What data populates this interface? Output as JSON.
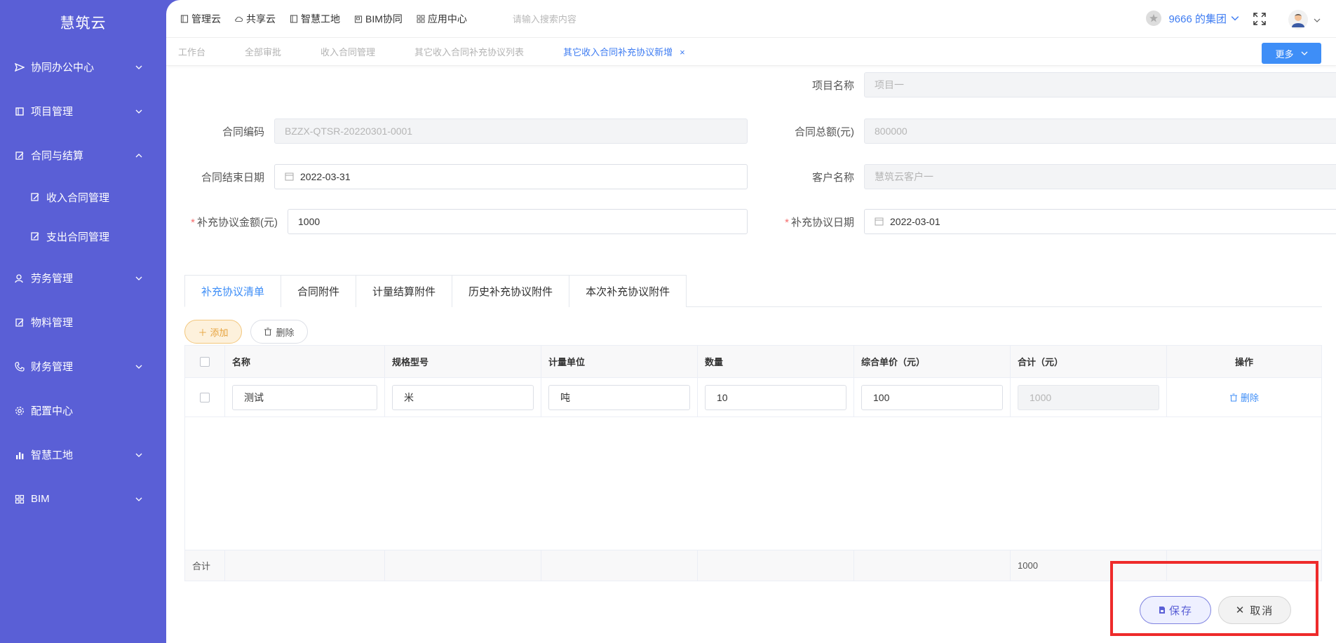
{
  "sidebar": {
    "title": "慧筑云",
    "items": [
      {
        "label": "协同办公中心",
        "icon": "send-icon",
        "expand": "down"
      },
      {
        "label": "项目管理",
        "icon": "book-icon",
        "expand": "down"
      },
      {
        "label": "合同与结算",
        "icon": "edit-doc-icon",
        "expand": "up"
      },
      {
        "label": "收入合同管理",
        "icon": "edit-doc-icon"
      },
      {
        "label": "支出合同管理",
        "icon": "edit-doc-icon"
      },
      {
        "label": "劳务管理",
        "icon": "user-icon",
        "expand": "down"
      },
      {
        "label": "物料管理",
        "icon": "edit-doc-icon"
      },
      {
        "label": "财务管理",
        "icon": "phone-icon",
        "expand": "down"
      },
      {
        "label": "配置中心",
        "icon": "gear-icon"
      },
      {
        "label": "智慧工地",
        "icon": "bar-chart-icon",
        "expand": "down"
      },
      {
        "label": "BIM",
        "icon": "grid-icon",
        "expand": "down"
      }
    ]
  },
  "topbar": {
    "nav": [
      "管理云",
      "共享云",
      "智慧工地",
      "BIM协同",
      "应用中心"
    ],
    "search_placeholder": "请输入搜索内容",
    "org": "9666 的集团"
  },
  "tabs": {
    "items": [
      "工作台",
      "全部审批",
      "收入合同管理",
      "其它收入合同补充协议列表",
      "其它收入合同补充协议新增"
    ],
    "close": "×",
    "more": "更多"
  },
  "form": {
    "project_name_label": "项目名称",
    "project_name": "项目一",
    "contract_code_label": "合同编码",
    "contract_code": "BZZX-QTSR-20220301-0001",
    "contract_total_label": "合同总额(元)",
    "contract_total": "800000",
    "contract_end_label": "合同结束日期",
    "contract_end": "2022-03-31",
    "customer_label": "客户名称",
    "customer": "慧筑云客户一",
    "supp_amount_label": "补充协议金额(元)",
    "supp_amount": "1000",
    "supp_date_label": "补充协议日期",
    "supp_date": "2022-03-01",
    "required_mark": "*"
  },
  "panel_tabs": [
    "补充协议清单",
    "合同附件",
    "计量结算附件",
    "历史补充协议附件",
    "本次补充协议附件"
  ],
  "actions": {
    "add": "添加",
    "delete": "删除"
  },
  "table": {
    "headers": [
      "名称",
      "规格型号",
      "计量单位",
      "数量",
      "综合单价（元）",
      "合计（元）",
      "操作"
    ],
    "rows": [
      {
        "name": "测试",
        "spec": "米",
        "unit": "吨",
        "qty": "10",
        "price": "100",
        "total": "1000",
        "op": "删除"
      }
    ],
    "footer_label": "合计",
    "footer_total": "1000"
  },
  "buttons": {
    "save": "保存",
    "cancel": "取消"
  },
  "colors": {
    "sidebar": "#5a5fd6",
    "primary": "#3e8ef7",
    "highlight": "#ee2b2b"
  }
}
